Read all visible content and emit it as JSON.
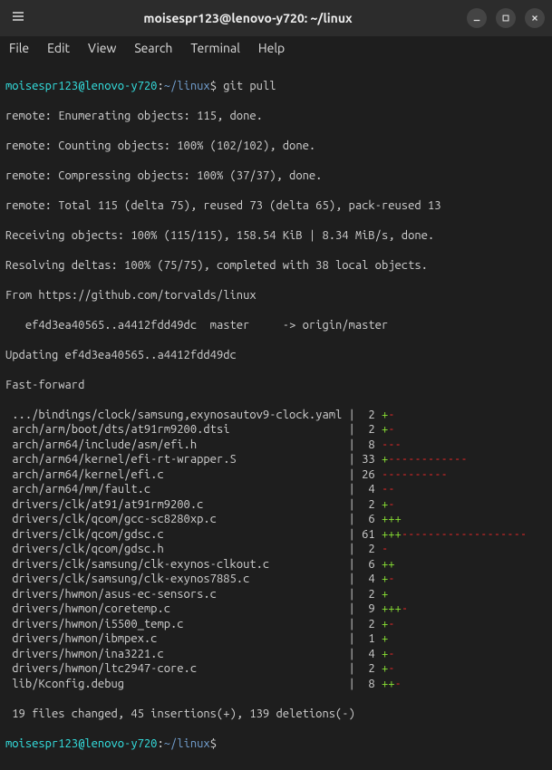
{
  "window": {
    "title": "moisespr123@lenovo-y720: ~/linux"
  },
  "menu": {
    "file": "File",
    "edit": "Edit",
    "view": "View",
    "search": "Search",
    "terminal": "Terminal",
    "help": "Help"
  },
  "prompt": {
    "userhost": "moisespr123@lenovo-y720",
    "colon": ":",
    "path": "~/linux",
    "dollar": "$ "
  },
  "command": "git pull",
  "output": {
    "l1": "remote: Enumerating objects: 115, done.",
    "l2": "remote: Counting objects: 100% (102/102), done.",
    "l3": "remote: Compressing objects: 100% (37/37), done.",
    "l4": "remote: Total 115 (delta 75), reused 73 (delta 65), pack-reused 13",
    "l5": "Receiving objects: 100% (115/115), 158.54 KiB | 8.34 MiB/s, done.",
    "l6": "Resolving deltas: 100% (75/75), completed with 38 local objects.",
    "l7": "From https://github.com/torvalds/linux",
    "l8": "   ef4d3ea40565..a4412fdd49dc  master     -> origin/master",
    "l9": "Updating ef4d3ea40565..a4412fdd49dc",
    "l10": "Fast-forward"
  },
  "files": [
    {
      "path": " .../bindings/clock/samsung,exynosautov9-clock.yaml |  2 ",
      "plus": "+",
      "dash": "-"
    },
    {
      "path": " arch/arm/boot/dts/at91rm9200.dtsi                  |  2 ",
      "plus": "+",
      "dash": "-"
    },
    {
      "path": " arch/arm64/include/asm/efi.h                       |  8 ",
      "plus": "",
      "dash": "---"
    },
    {
      "path": " arch/arm64/kernel/efi-rt-wrapper.S                 | 33 ",
      "plus": "+",
      "dash": "------------"
    },
    {
      "path": " arch/arm64/kernel/efi.c                            | 26 ",
      "plus": "",
      "dash": "----------"
    },
    {
      "path": " arch/arm64/mm/fault.c                              |  4 ",
      "plus": "",
      "dash": "--"
    },
    {
      "path": " drivers/clk/at91/at91rm9200.c                      |  2 ",
      "plus": "+",
      "dash": "-"
    },
    {
      "path": " drivers/clk/qcom/gcc-sc8280xp.c                    |  6 ",
      "plus": "+++",
      "dash": ""
    },
    {
      "path": " drivers/clk/qcom/gdsc.c                            | 61 ",
      "plus": "+++",
      "dash": "-------------------"
    },
    {
      "path": " drivers/clk/qcom/gdsc.h                            |  2 ",
      "plus": "",
      "dash": "-"
    },
    {
      "path": " drivers/clk/samsung/clk-exynos-clkout.c            |  6 ",
      "plus": "++",
      "dash": ""
    },
    {
      "path": " drivers/clk/samsung/clk-exynos7885.c               |  4 ",
      "plus": "+",
      "dash": "-"
    },
    {
      "path": " drivers/hwmon/asus-ec-sensors.c                    |  2 ",
      "plus": "+",
      "dash": ""
    },
    {
      "path": " drivers/hwmon/coretemp.c                           |  9 ",
      "plus": "+++",
      "dash": "-"
    },
    {
      "path": " drivers/hwmon/i5500_temp.c                         |  2 ",
      "plus": "+",
      "dash": "-"
    },
    {
      "path": " drivers/hwmon/ibmpex.c                             |  1 ",
      "plus": "+",
      "dash": ""
    },
    {
      "path": " drivers/hwmon/ina3221.c                            |  4 ",
      "plus": "+",
      "dash": "-"
    },
    {
      "path": " drivers/hwmon/ltc2947-core.c                       |  2 ",
      "plus": "+",
      "dash": "-"
    },
    {
      "path": " lib/Kconfig.debug                                  |  8 ",
      "plus": "++",
      "dash": "-"
    }
  ],
  "summary": " 19 files changed, 45 insertions(+), 139 deletions(-)"
}
